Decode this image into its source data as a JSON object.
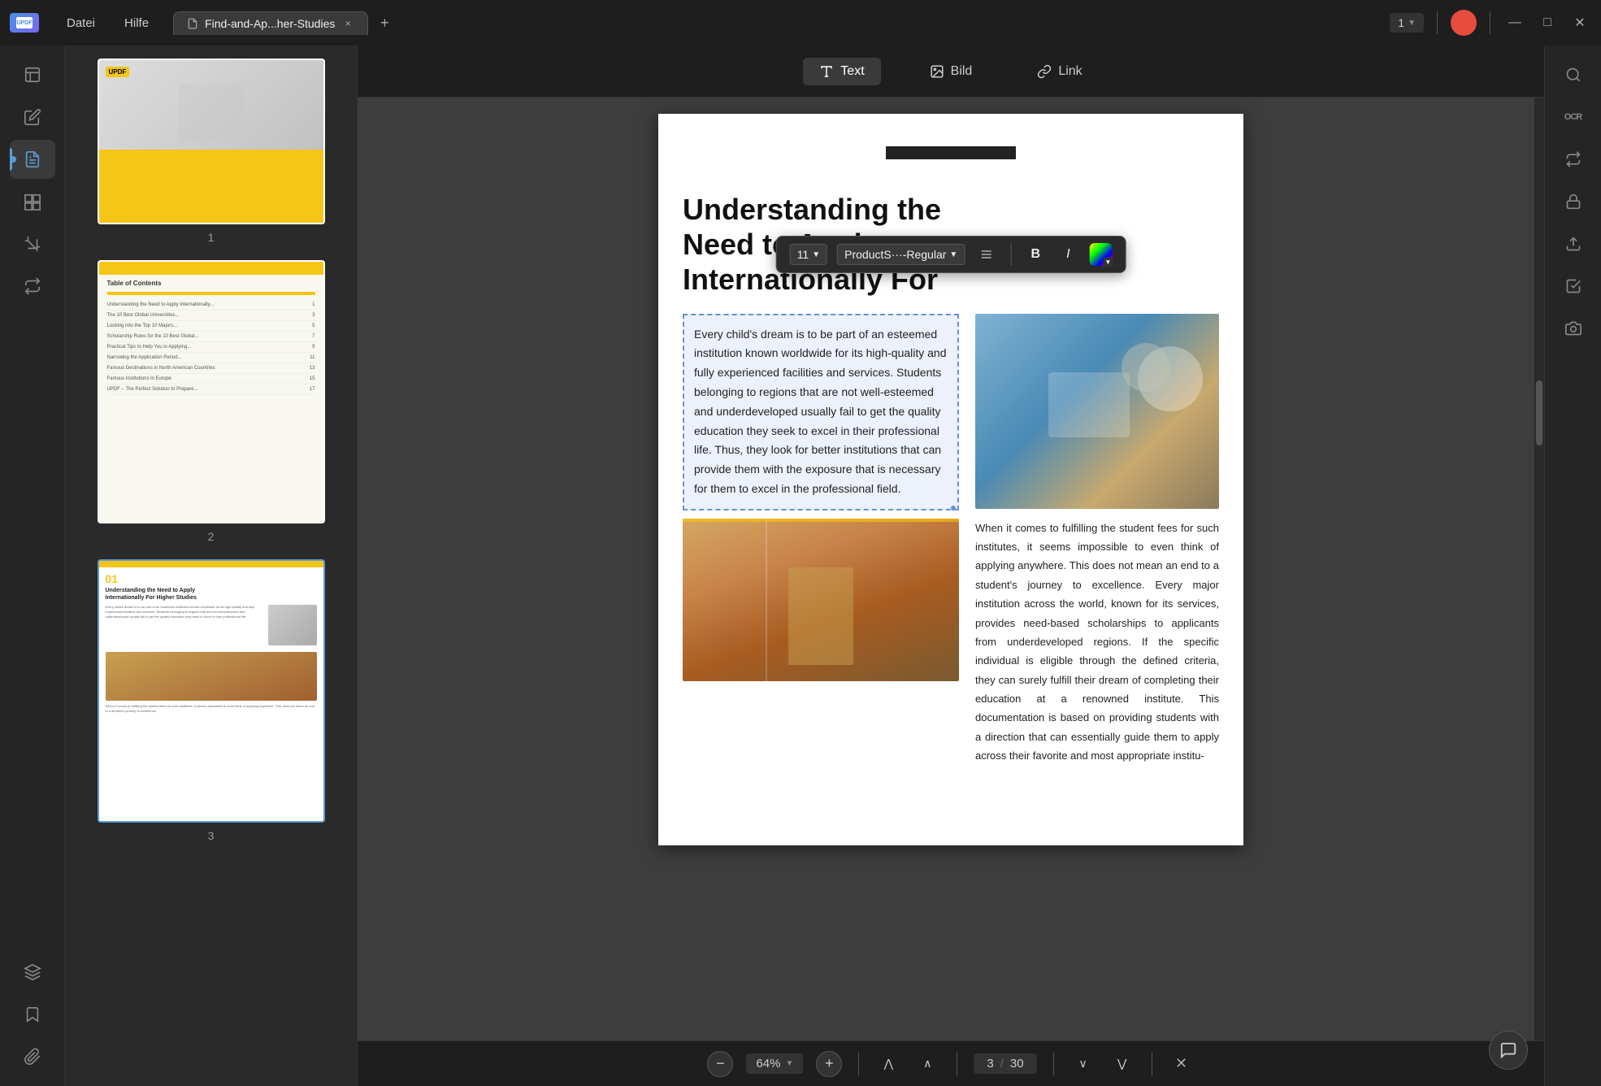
{
  "app": {
    "logo": "UPDF",
    "menu": {
      "datei": "Datei",
      "hilfe": "Hilfe"
    },
    "tab": {
      "label": "Find-and-Ap...her-Studies",
      "close_label": "×"
    },
    "new_tab": "+",
    "page_nav": "1",
    "window_controls": {
      "minimize": "—",
      "maximize": "□",
      "close": "✕"
    }
  },
  "left_sidebar": {
    "icons": [
      {
        "name": "document-icon",
        "symbol": "📄",
        "active": false
      },
      {
        "name": "edit-icon",
        "symbol": "✏️",
        "active": false
      },
      {
        "name": "annotate-icon",
        "symbol": "📝",
        "active": true
      },
      {
        "name": "pages-icon",
        "symbol": "⊞",
        "active": false
      },
      {
        "name": "crop-icon",
        "symbol": "⊡",
        "active": false
      },
      {
        "name": "convert-icon",
        "symbol": "⇄",
        "active": false
      },
      {
        "name": "layers-icon",
        "symbol": "◈",
        "active": false
      },
      {
        "name": "bookmark-icon",
        "symbol": "🔖",
        "active": false
      },
      {
        "name": "attachment-icon",
        "symbol": "📎",
        "active": false
      }
    ]
  },
  "thumbnails": [
    {
      "number": "1"
    },
    {
      "number": "2",
      "title": "Table of Contents"
    },
    {
      "number": "3"
    }
  ],
  "toolbar": {
    "text_label": "Text",
    "bild_label": "Bild",
    "link_label": "Link"
  },
  "text_edit_toolbar": {
    "font_size": "11",
    "font_family": "ProductS···-Regular",
    "bold_label": "B",
    "italic_label": "I"
  },
  "pdf_content": {
    "header_bar_alt": "decorative bar",
    "main_title": "Understanding the Need to Apply Internationally For",
    "selected_paragraph": "Every child's dream is to be part of an esteemed institution known worldwide for its high-quality and fully experienced facilities and services. Students belonging to regions that are not well-esteemed and underdeveloped usually fail to get the quality education they seek to excel in their professional life. Thus, they look for better institutions that can provide them with the exposure that is necessary for them to excel in the professional field.",
    "right_paragraph": "When it comes to fulfilling the student fees for such institutes, it seems impossible to even think of applying anywhere. This does not mean an end to a student's journey to excellence. Every major institution across the world, known for its services, provides need-based scholarships to applicants from underdeveloped regions. If the specific individual is eligible through the defined criteria, they can surely fulfill their dream of completing their education at a renowned institute. This documentation is based on providing students with a direction that can essentially guide them to apply across their favorite and most appropriate institu-"
  },
  "bottom_bar": {
    "zoom_percent": "64%",
    "current_page": "3",
    "total_pages": "30",
    "separator": "/"
  },
  "right_sidebar": {
    "icons": [
      {
        "name": "search-right-icon",
        "symbol": "🔍"
      },
      {
        "name": "ocr-icon",
        "symbol": "OCR"
      },
      {
        "name": "convert-right-icon",
        "symbol": "⇄"
      },
      {
        "name": "protect-icon",
        "symbol": "🔒"
      },
      {
        "name": "share-icon",
        "symbol": "↑"
      },
      {
        "name": "check-icon",
        "symbol": "✓"
      },
      {
        "name": "snapshot-icon",
        "symbol": "📷"
      }
    ]
  }
}
